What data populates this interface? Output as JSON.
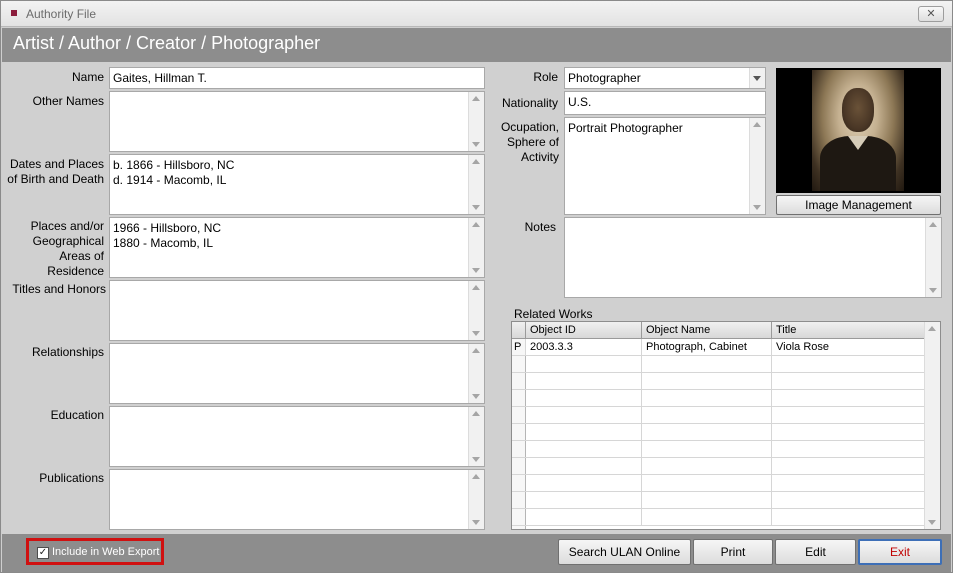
{
  "window": {
    "title": "Authority File",
    "close_glyph": "✕"
  },
  "header": {
    "title": "Artist / Author / Creator / Photographer"
  },
  "left_fields": {
    "name": {
      "label": "Name",
      "value": "Gaites, Hillman T."
    },
    "other_names": {
      "label": "Other Names",
      "value": ""
    },
    "dates": {
      "label": "Dates and Places of Birth and Death",
      "value": "b. 1866 - Hillsboro, NC\nd. 1914 - Macomb, IL"
    },
    "places": {
      "label": "Places and/or Geographical Areas of Residence",
      "value": "1966 - Hillsboro, NC\n1880 - Macomb, IL"
    },
    "titles": {
      "label": "Titles and Honors",
      "value": ""
    },
    "relationships": {
      "label": "Relationships",
      "value": ""
    },
    "education": {
      "label": "Education",
      "value": ""
    },
    "publications": {
      "label": "Publications",
      "value": ""
    }
  },
  "right_fields": {
    "role": {
      "label": "Role",
      "value": "Photographer"
    },
    "nationality": {
      "label": "Nationality",
      "value": "U.S."
    },
    "occupation": {
      "label": "Ocupation, Sphere of Activity",
      "value": "Portrait Photographer"
    },
    "notes": {
      "label": "Notes",
      "value": ""
    }
  },
  "image": {
    "icon": "portrait-photo",
    "button_label": "Image Management"
  },
  "related_works": {
    "label": "Related Works",
    "columns": [
      "Object ID",
      "Object Name",
      "Title"
    ],
    "rows": [
      {
        "marker": "P",
        "object_id": "2003.3.3",
        "object_name": "Photograph, Cabinet",
        "title": "Viola Rose"
      }
    ]
  },
  "footer": {
    "checkbox_checked": true,
    "checkbox_glyph": "✓",
    "web_export_label": "Include in Web Export",
    "buttons": {
      "search_ulan": "Search ULAN Online",
      "print": "Print",
      "edit": "Edit",
      "exit": "Exit"
    }
  },
  "colors": {
    "header_bg": "#8d8d8d",
    "content_bg": "#d0d0d0",
    "highlight_border": "#d01010",
    "exit_text": "#c00000"
  }
}
